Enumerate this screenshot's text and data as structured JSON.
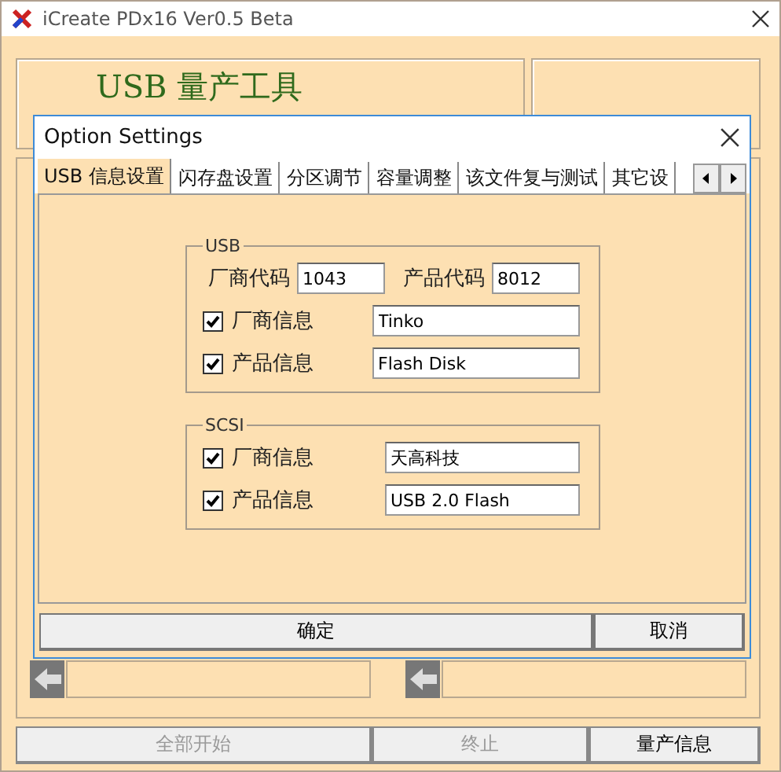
{
  "window": {
    "title": "iCreate PDx16 Ver0.5 Beta",
    "banner": "USB 量产工具"
  },
  "dialog": {
    "title": "Option Settings",
    "tabs": [
      {
        "label": "USB 信息设置",
        "selected": true
      },
      {
        "label": "闪存盘设置",
        "selected": false
      },
      {
        "label": "分区调节",
        "selected": false
      },
      {
        "label": "容量调整",
        "selected": false
      },
      {
        "label": "该文件复与测试",
        "selected": false
      },
      {
        "label": "其它设",
        "selected": false
      }
    ],
    "groups": [
      {
        "title": "USB",
        "codes": [
          {
            "label": "厂商代码",
            "value": "1043"
          },
          {
            "label": "产品代码",
            "value": "8012"
          }
        ],
        "rows": [
          {
            "label": "厂商信息",
            "checked": true,
            "value": "Tinko"
          },
          {
            "label": "产品信息",
            "checked": true,
            "value": "Flash Disk"
          }
        ]
      },
      {
        "title": "SCSI",
        "rows": [
          {
            "label": "厂商信息",
            "checked": true,
            "value": "天高科技"
          },
          {
            "label": "产品信息",
            "checked": true,
            "value": "USB 2.0 Flash"
          }
        ]
      }
    ],
    "buttons": [
      "确定",
      "取消"
    ]
  },
  "footer_buttons": [
    {
      "label": "全部开始",
      "disabled": true
    },
    {
      "label": "终止",
      "disabled": true
    },
    {
      "label": "量产信息",
      "disabled": false
    }
  ]
}
